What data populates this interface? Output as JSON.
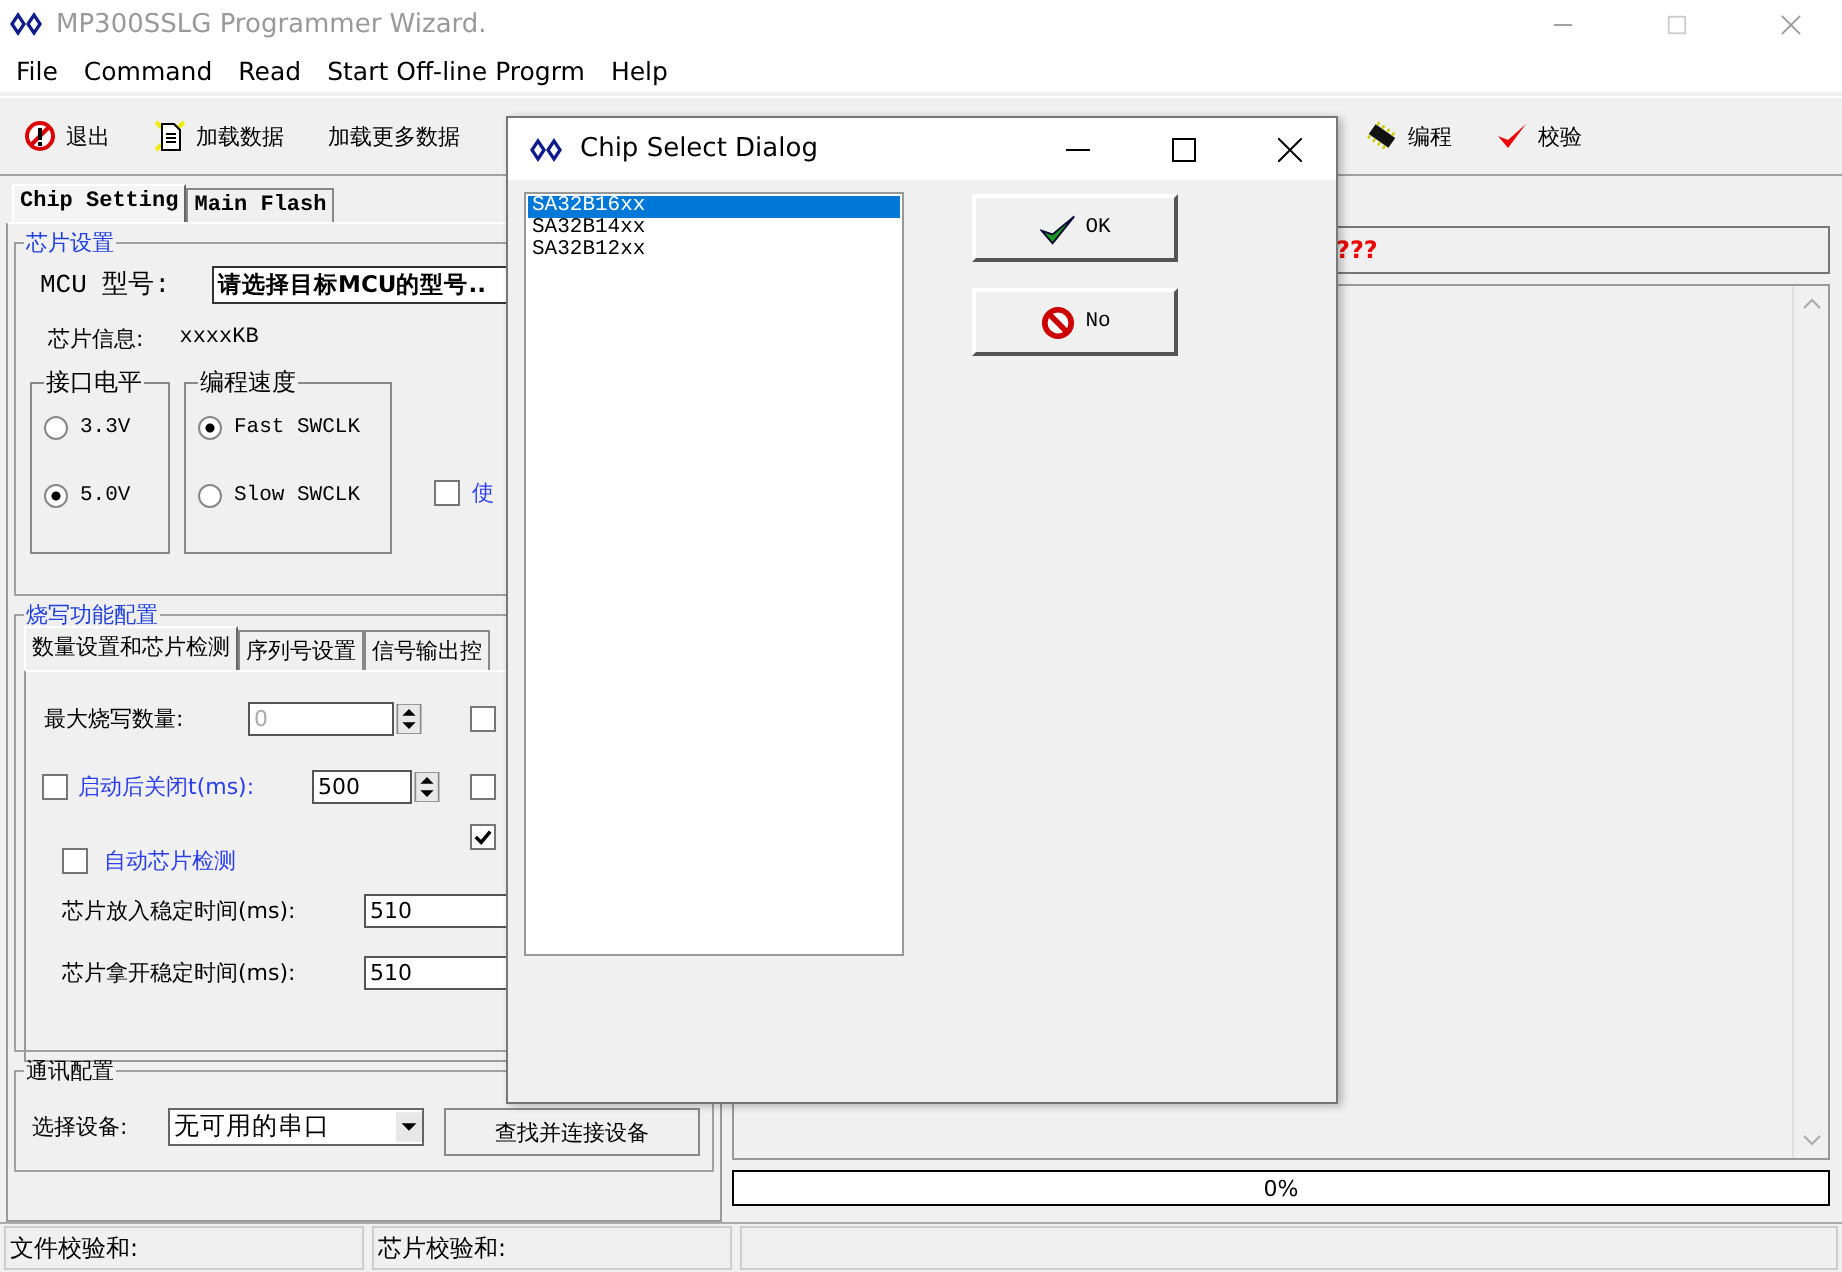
{
  "window": {
    "title": "MP300SSLG Programmer Wizard."
  },
  "menu": [
    "File",
    "Command",
    "Read",
    "Start Off-line Progrm",
    "Help"
  ],
  "toolbar_left": [
    {
      "label": "退出",
      "kind": "exit"
    },
    {
      "label": "加载数据",
      "kind": "load"
    },
    {
      "label": "加载更多数据",
      "kind": "plain"
    }
  ],
  "toolbar_right": [
    {
      "label": "编程",
      "kind": "chip"
    },
    {
      "label": "校验",
      "kind": "check"
    }
  ],
  "chip_tabs": [
    {
      "label": "Chip Setting",
      "selected": true
    },
    {
      "label": "Main Flash",
      "selected": false
    }
  ],
  "chip_settings": {
    "title": "芯片设置",
    "mcu_label": "MCU 型号:",
    "mcu_value": "请选择目标MCU的型号..",
    "info_label": "芯片信息:",
    "info_value": "xxxxKB",
    "voltage": {
      "title": "接口电平",
      "options": [
        {
          "label": "3.3V",
          "selected": false
        },
        {
          "label": "5.0V",
          "selected": true
        }
      ]
    },
    "speed": {
      "title": "编程速度",
      "options": [
        {
          "label": "Fast SWCLK",
          "selected": true
        },
        {
          "label": "Slow SWCLK",
          "selected": false
        }
      ]
    },
    "option": {
      "label": "使",
      "checked": false
    }
  },
  "burn_config": {
    "title": "烧写功能配置",
    "tabs": [
      {
        "label": "数量设置和芯片检测",
        "selected": true
      },
      {
        "label": "序列号设置",
        "selected": false
      },
      {
        "label": "信号输出控",
        "selected": false
      }
    ],
    "max_count": {
      "label": "最大烧写数量:",
      "value": "0",
      "disabled": true
    },
    "auto_close": {
      "label": "启动后关闭t(ms):",
      "checked": false,
      "value": "500"
    },
    "side_checks": [
      {
        "checked": false
      },
      {
        "checked": false
      },
      {
        "checked": true
      }
    ],
    "auto_detect": {
      "label": "自动芯片检测",
      "checked": false
    },
    "insert_time": {
      "label": "芯片放入稳定时间(ms):",
      "value": "510"
    },
    "remove_time": {
      "label": "芯片拿开稳定时间(ms):",
      "value": "510"
    }
  },
  "comm": {
    "title": "通讯配置",
    "device_label": "选择设备:",
    "device_value": "无可用的串口",
    "connect_button": "查找并连接设备"
  },
  "status_message": "???",
  "progress": {
    "level": 0,
    "label": "0%"
  },
  "status_bar": [
    "文件校验和:",
    "芯片校验和:"
  ],
  "dialog": {
    "title": "Chip Select Dialog",
    "chips": [
      {
        "label": "SA32B16xx",
        "selected": true
      },
      {
        "label": "SA32B14xx",
        "selected": false
      },
      {
        "label": "SA32B12xx",
        "selected": false
      }
    ],
    "ok": "OK",
    "no": "No"
  }
}
